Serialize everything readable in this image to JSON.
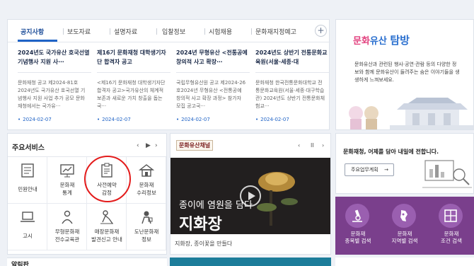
{
  "news": {
    "tabs": [
      "공지사항",
      "보도자료",
      "설명자료",
      "입찰정보",
      "시험채용",
      "문화재지정예고"
    ],
    "more_label": "+",
    "cards": [
      {
        "title": "2024년도 국가유산 호국선열 기념행사 지원 사·‧‧",
        "body": "문화재청 공고 제2024-81호 2024년도 국가유산 호국선열 기념행사 지원 사업 추가 공모 문화재청에서는 국가유‧‧‧",
        "date": "2024-02-07"
      },
      {
        "title": "제16기 문화재청 대학생기자단 합격자 공고",
        "body": "<제16기 문화재청 대학생기자단 합격자 공고>국가유산의 체계적 보존과 새로운 가치 창출을 돕는 국‧‧‧",
        "date": "2024-02-07"
      },
      {
        "title": "2024년 무형유산 <전통공예 창의적 사고 확장‧‧‧",
        "body": "국립무형유산원 공고 제2024-26호2024년 무형유산 <전통공예 창의적 사고 확장 과정> 참가자 모집 공고국‧‧‧",
        "date": "2024-02-07"
      },
      {
        "title": "2024년도 상반기 전통문화교육원(서울·세종·대",
        "body": "문화재청 한국전통문화대학교 전통문화교육원(서울·세종·대구학습관) 2024년도 상반기 전통문화체험교‧‧‧",
        "date": "2024-02-07"
      }
    ]
  },
  "heritage": {
    "brand_part1": "문화",
    "brand_part2": "유산",
    "brand_part3": "탐방",
    "description": "문화유산과 관련된 행사·공연·관람 등의 다양한 정보와 함께 문화유산이 들려주는 숨은 이야기들을 생생하게 느껴보세요."
  },
  "services": {
    "heading": "주요서비스",
    "prev": "‹",
    "pause": "▶",
    "next": "›",
    "items": [
      {
        "label": "민원안내",
        "icon": "document-icon"
      },
      {
        "label": "문화재\n통계",
        "icon": "chart-icon"
      },
      {
        "label": "사전예약\n감정",
        "icon": "clipboard-icon"
      },
      {
        "label": "문화재\n수리정보",
        "icon": "house-icon"
      },
      {
        "label": "고시",
        "icon": "laptop-icon"
      },
      {
        "label": "무형문화재\n전수교육관",
        "icon": "person-icon"
      },
      {
        "label": "매장문화재\n발견신고 안내",
        "icon": "excavation-icon"
      },
      {
        "label": "도난문화재\n정보",
        "icon": "thief-icon"
      }
    ]
  },
  "video": {
    "channel": "문화유산채널",
    "prev": "‹",
    "pause": "II",
    "next": "›",
    "overlay_line1": "종이에 염원을 담다",
    "overlay_line2": "지화장",
    "caption": "지화장, 종이꽃을 만들다"
  },
  "promo": {
    "title": "문화재청, 어제를 담아 내일에 전합니다.",
    "button_label": "주요업무계획",
    "button_arrow": "→"
  },
  "search_panel": [
    {
      "label": "문화재\n종목별 검색",
      "icon": "microscope-icon"
    },
    {
      "label": "문화재\n지역별 검색",
      "icon": "map-icon"
    },
    {
      "label": "문화재\n조건 검색",
      "icon": "grid-icon"
    }
  ],
  "bottom": {
    "left_heading": "알림판"
  },
  "colors": {
    "accent": "#1f63c6",
    "highlight": "#e31b1b",
    "search_bg": "#7a3f8c"
  }
}
